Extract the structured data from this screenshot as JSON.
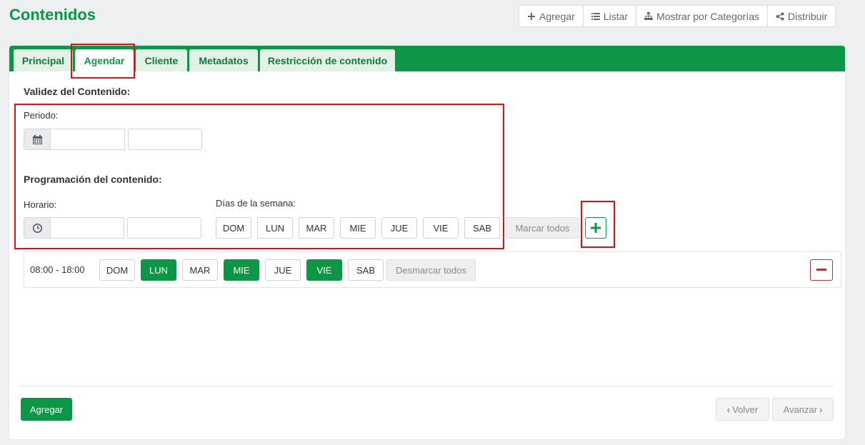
{
  "page": {
    "title": "Contenidos"
  },
  "top_actions": [
    {
      "label": "Agregar",
      "icon": "plus-icon"
    },
    {
      "label": "Listar",
      "icon": "list-icon"
    },
    {
      "label": "Mostrar por Categorías",
      "icon": "sitemap-icon"
    },
    {
      "label": "Distribuir",
      "icon": "share-icon"
    }
  ],
  "tabs": [
    {
      "label": "Principal",
      "active": false
    },
    {
      "label": "Agendar",
      "active": true
    },
    {
      "label": "Cliente",
      "active": false
    },
    {
      "label": "Metadatos",
      "active": false
    },
    {
      "label": "Restricción de contenido",
      "active": false
    }
  ],
  "form": {
    "validez_title": "Validez del Contenido:",
    "periodo_label": "Periodo:",
    "periodo_start": "",
    "periodo_end": "",
    "programacion_title": "Programación del contenido:",
    "horario_label": "Horario:",
    "horario_start": "",
    "horario_end": "",
    "dias_label": "Días de la semana:",
    "days": [
      "DOM",
      "LUN",
      "MAR",
      "MIE",
      "JUE",
      "VIE",
      "SAB"
    ],
    "mark_all_label": "Marcar todos"
  },
  "schedule": {
    "range": "08:00 - 18:00",
    "days": [
      {
        "label": "DOM",
        "selected": false
      },
      {
        "label": "LUN",
        "selected": true
      },
      {
        "label": "MAR",
        "selected": false
      },
      {
        "label": "MIE",
        "selected": true
      },
      {
        "label": "JUE",
        "selected": false
      },
      {
        "label": "VIE",
        "selected": true
      },
      {
        "label": "SAB",
        "selected": false
      }
    ],
    "unmark_all_label": "Desmarcar todos"
  },
  "footer": {
    "submit_label": "Agregar",
    "back_label": "Volver",
    "next_label": "Avanzar"
  },
  "colors": {
    "brand_green": "#0e9647",
    "danger": "#a93a3a",
    "highlight_red": "#dd1111"
  }
}
